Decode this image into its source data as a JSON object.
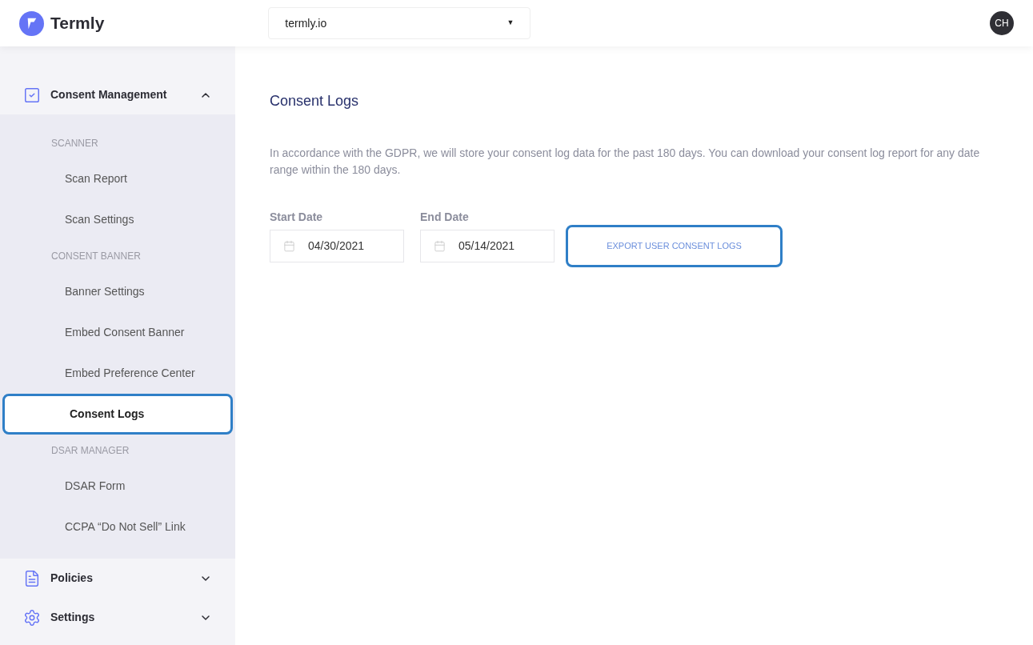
{
  "header": {
    "brand": "Termly",
    "site_select": {
      "value": "termly.io",
      "caret": "▼"
    },
    "avatar": "CH"
  },
  "sidebar": {
    "sections": [
      {
        "label": "Consent Management",
        "kind": "consent",
        "expanded": true,
        "groups": [
          {
            "heading": "SCANNER",
            "items": [
              {
                "label": "Scan Report",
                "selected": false
              },
              {
                "label": "Scan Settings",
                "selected": false
              }
            ]
          },
          {
            "heading": "CONSENT BANNER",
            "items": [
              {
                "label": "Banner Settings",
                "selected": false
              },
              {
                "label": "Embed Consent Banner",
                "selected": false
              },
              {
                "label": "Embed Preference Center",
                "selected": false
              },
              {
                "label": "Consent Logs",
                "selected": true
              }
            ]
          },
          {
            "heading": "DSAR MANAGER",
            "items": [
              {
                "label": "DSAR Form",
                "selected": false
              },
              {
                "label": "CCPA “Do Not Sell” Link",
                "selected": false
              }
            ]
          }
        ]
      },
      {
        "label": "Policies",
        "kind": "policies",
        "expanded": false
      },
      {
        "label": "Settings",
        "kind": "settings",
        "expanded": false
      }
    ]
  },
  "main": {
    "title": "Consent Logs",
    "description": "In accordance with the GDPR, we will store your consent log data for the past 180 days. You can download your consent log report for any date range within the 180 days.",
    "fields": [
      {
        "label": "Start Date",
        "value": "04/30/2021"
      },
      {
        "label": "End Date",
        "value": "05/14/2021"
      }
    ],
    "export_button": "EXPORT USER CONSENT LOGS"
  }
}
